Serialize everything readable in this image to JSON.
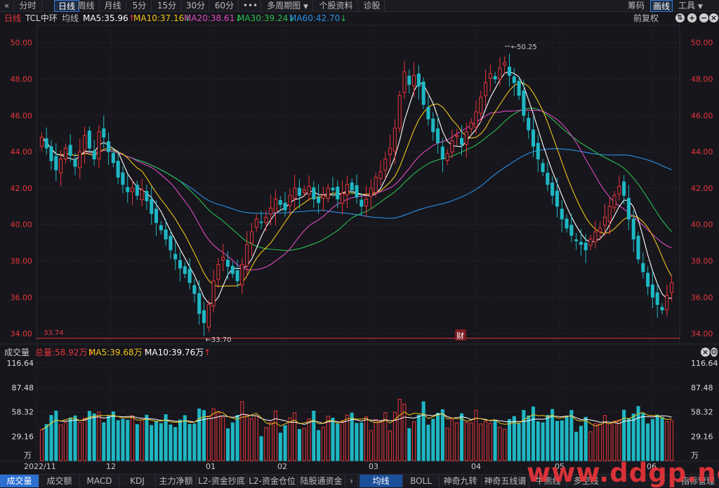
{
  "topbar": {
    "back_icon": "double-chevron-left-icon",
    "tabs": [
      "分时",
      "日线",
      "周线",
      "月线",
      "5分",
      "15分",
      "30分",
      "60分",
      "•••",
      "多周期图",
      "个股资料",
      "诊股"
    ],
    "active_tab": "日线",
    "right_items": [
      "筹码",
      "画线",
      "工具"
    ],
    "active_right": "画线"
  },
  "legend": {
    "period": "日线",
    "stock_name": "TCL中环",
    "ma_label": "均线",
    "ma5": "MA5:35.96",
    "ma10": "MA10:37.16",
    "ma20": "MA20:38.61",
    "ma30": "MA30:39.24",
    "ma60": "MA60:42.70",
    "arrows": {
      "ma5": "↑",
      "ma10": "↓",
      "ma20": "↓",
      "ma30": "↓",
      "ma60": "↓"
    },
    "adjust": "前复权"
  },
  "price_axis": [
    "50.00",
    "48.00",
    "46.00",
    "44.00",
    "42.00",
    "40.00",
    "38.00",
    "36.00",
    "34.00"
  ],
  "annotations": {
    "high": "50.25",
    "low": "33.70",
    "line_level": "33.74",
    "finance_marker": "财"
  },
  "vol_legend": {
    "title": "成交量",
    "total": "总量:58.92万",
    "ma5": "MA5:39.68万",
    "ma10": "MA10:39.76万"
  },
  "vol_axis": [
    "116.64",
    "87.48",
    "58.32",
    "29.16",
    "万"
  ],
  "x_axis": [
    "2022/11",
    "12",
    "01",
    "02",
    "03",
    "04",
    "05",
    "06"
  ],
  "bottombar": {
    "tabs": [
      "成交量",
      "成交额",
      "MACD",
      "KDJ",
      "主力净额",
      "L2-资金抄底",
      "L2-资金仓位",
      "陆股通资金"
    ],
    "arrow": "›",
    "tabs2": [
      "均线",
      "BOLL",
      "神奇九转",
      "神奇五线谱",
      "牛熊线",
      "多空线"
    ],
    "right": "指标管理",
    "active": "成交量",
    "active2": "均线"
  },
  "watermark": "www.ddgp.net",
  "colors": {
    "up": "#e8363a",
    "down": "#1fb7c4",
    "ma5": "#ffffff",
    "ma10": "#f0c419",
    "ma20": "#e04bc0",
    "ma30": "#2dbe4e",
    "ma60": "#2b8fe6",
    "axis_text": "#e8363a"
  },
  "chart_data": [
    {
      "type": "candlestick",
      "title": "TCL中环 日线",
      "y_range": [
        33.5,
        50.8
      ],
      "x_months": [
        "2022/11",
        "12",
        "01",
        "02",
        "03",
        "04",
        "05",
        "06"
      ],
      "close_series": [
        44.8,
        44.2,
        43.5,
        43.0,
        43.6,
        44.2,
        43.8,
        43.2,
        44.0,
        44.9,
        44.2,
        43.6,
        45.1,
        44.8,
        44.0,
        43.4,
        42.6,
        42.2,
        41.8,
        42.0,
        41.6,
        41.9,
        41.3,
        40.6,
        40.1,
        39.7,
        39.2,
        38.6,
        38.1,
        37.6,
        37.3,
        36.8,
        36.2,
        35.1,
        34.6,
        35.6,
        36.9,
        37.8,
        38.2,
        37.7,
        37.3,
        36.9,
        37.8,
        38.9,
        39.6,
        40.3,
        40.1,
        40.4,
        40.9,
        41.4,
        41.1,
        40.8,
        41.6,
        42.0,
        41.6,
        41.9,
        42.1,
        41.4,
        41.2,
        41.6,
        42.0,
        41.9,
        41.4,
        41.7,
        42.2,
        41.9,
        41.5,
        41.0,
        41.4,
        42.0,
        42.6,
        42.9,
        43.6,
        44.2,
        45.3,
        47.1,
        48.4,
        47.7,
        48.2,
        47.6,
        46.6,
        45.8,
        45.1,
        44.5,
        43.6,
        43.9,
        44.6,
        44.9,
        44.4,
        45.1,
        45.6,
        46.2,
        47.0,
        47.8,
        48.3,
        48.0,
        48.6,
        48.9,
        48.2,
        47.8,
        47.1,
        46.0,
        45.2,
        44.3,
        43.6,
        42.9,
        42.2,
        41.6,
        41.0,
        40.3,
        39.8,
        39.4,
        39.1,
        38.9,
        38.6,
        39.2,
        39.6,
        39.8,
        40.4,
        41.0,
        41.6,
        42.1,
        41.6,
        40.3,
        39.2,
        38.1,
        37.4,
        36.6,
        36.0,
        35.6,
        35.3,
        36.1,
        36.8
      ]
    },
    {
      "type": "bar",
      "title": "成交量",
      "y_range": [
        0,
        120
      ],
      "unit": "万",
      "ma5": 39.68,
      "ma10": 39.76,
      "total": 58.92
    }
  ]
}
